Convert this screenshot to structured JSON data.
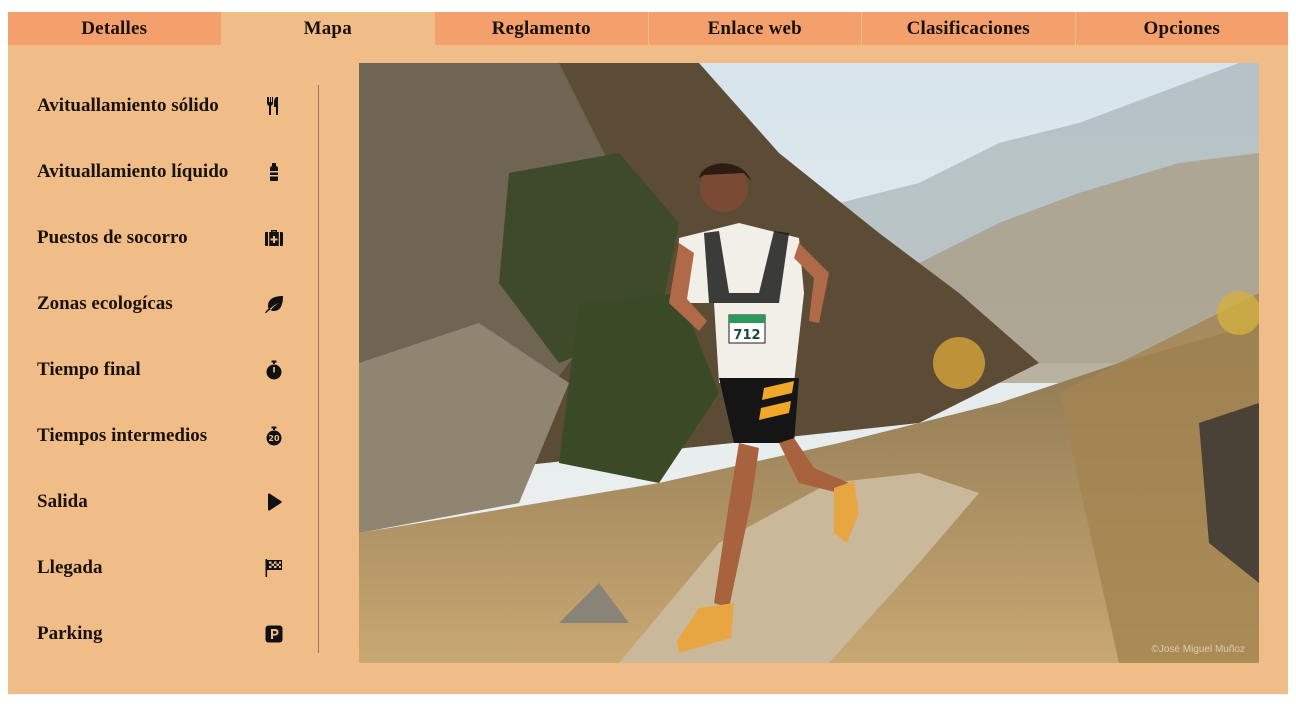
{
  "tabs": [
    {
      "label": "Detalles",
      "active": false
    },
    {
      "label": "Mapa",
      "active": true
    },
    {
      "label": "Reglamento",
      "active": false
    },
    {
      "label": "Enlace web",
      "active": false
    },
    {
      "label": "Clasificaciones",
      "active": false
    },
    {
      "label": "Opciones",
      "active": false
    }
  ],
  "legend": [
    {
      "label": "Avituallamiento sólido",
      "icon": "utensils-icon"
    },
    {
      "label": "Avituallamiento líquido",
      "icon": "bottle-icon"
    },
    {
      "label": "Puestos de socorro",
      "icon": "first-aid-kit-icon"
    },
    {
      "label": "Zonas ecologícas",
      "icon": "leaf-icon"
    },
    {
      "label": "Tiempo final",
      "icon": "stopwatch-icon"
    },
    {
      "label": "Tiempos intermedios",
      "icon": "stopwatch-20-icon"
    },
    {
      "label": "Salida",
      "icon": "play-icon"
    },
    {
      "label": "Llegada",
      "icon": "checkered-flag-icon"
    },
    {
      "label": "Parking",
      "icon": "parking-icon"
    }
  ],
  "photo": {
    "bib_number": "712",
    "credit": "©José Miguel Muñoz"
  },
  "colors": {
    "background": "#f0bd89",
    "tab": "#f4a06c",
    "tab_active": "#f0bd89"
  }
}
